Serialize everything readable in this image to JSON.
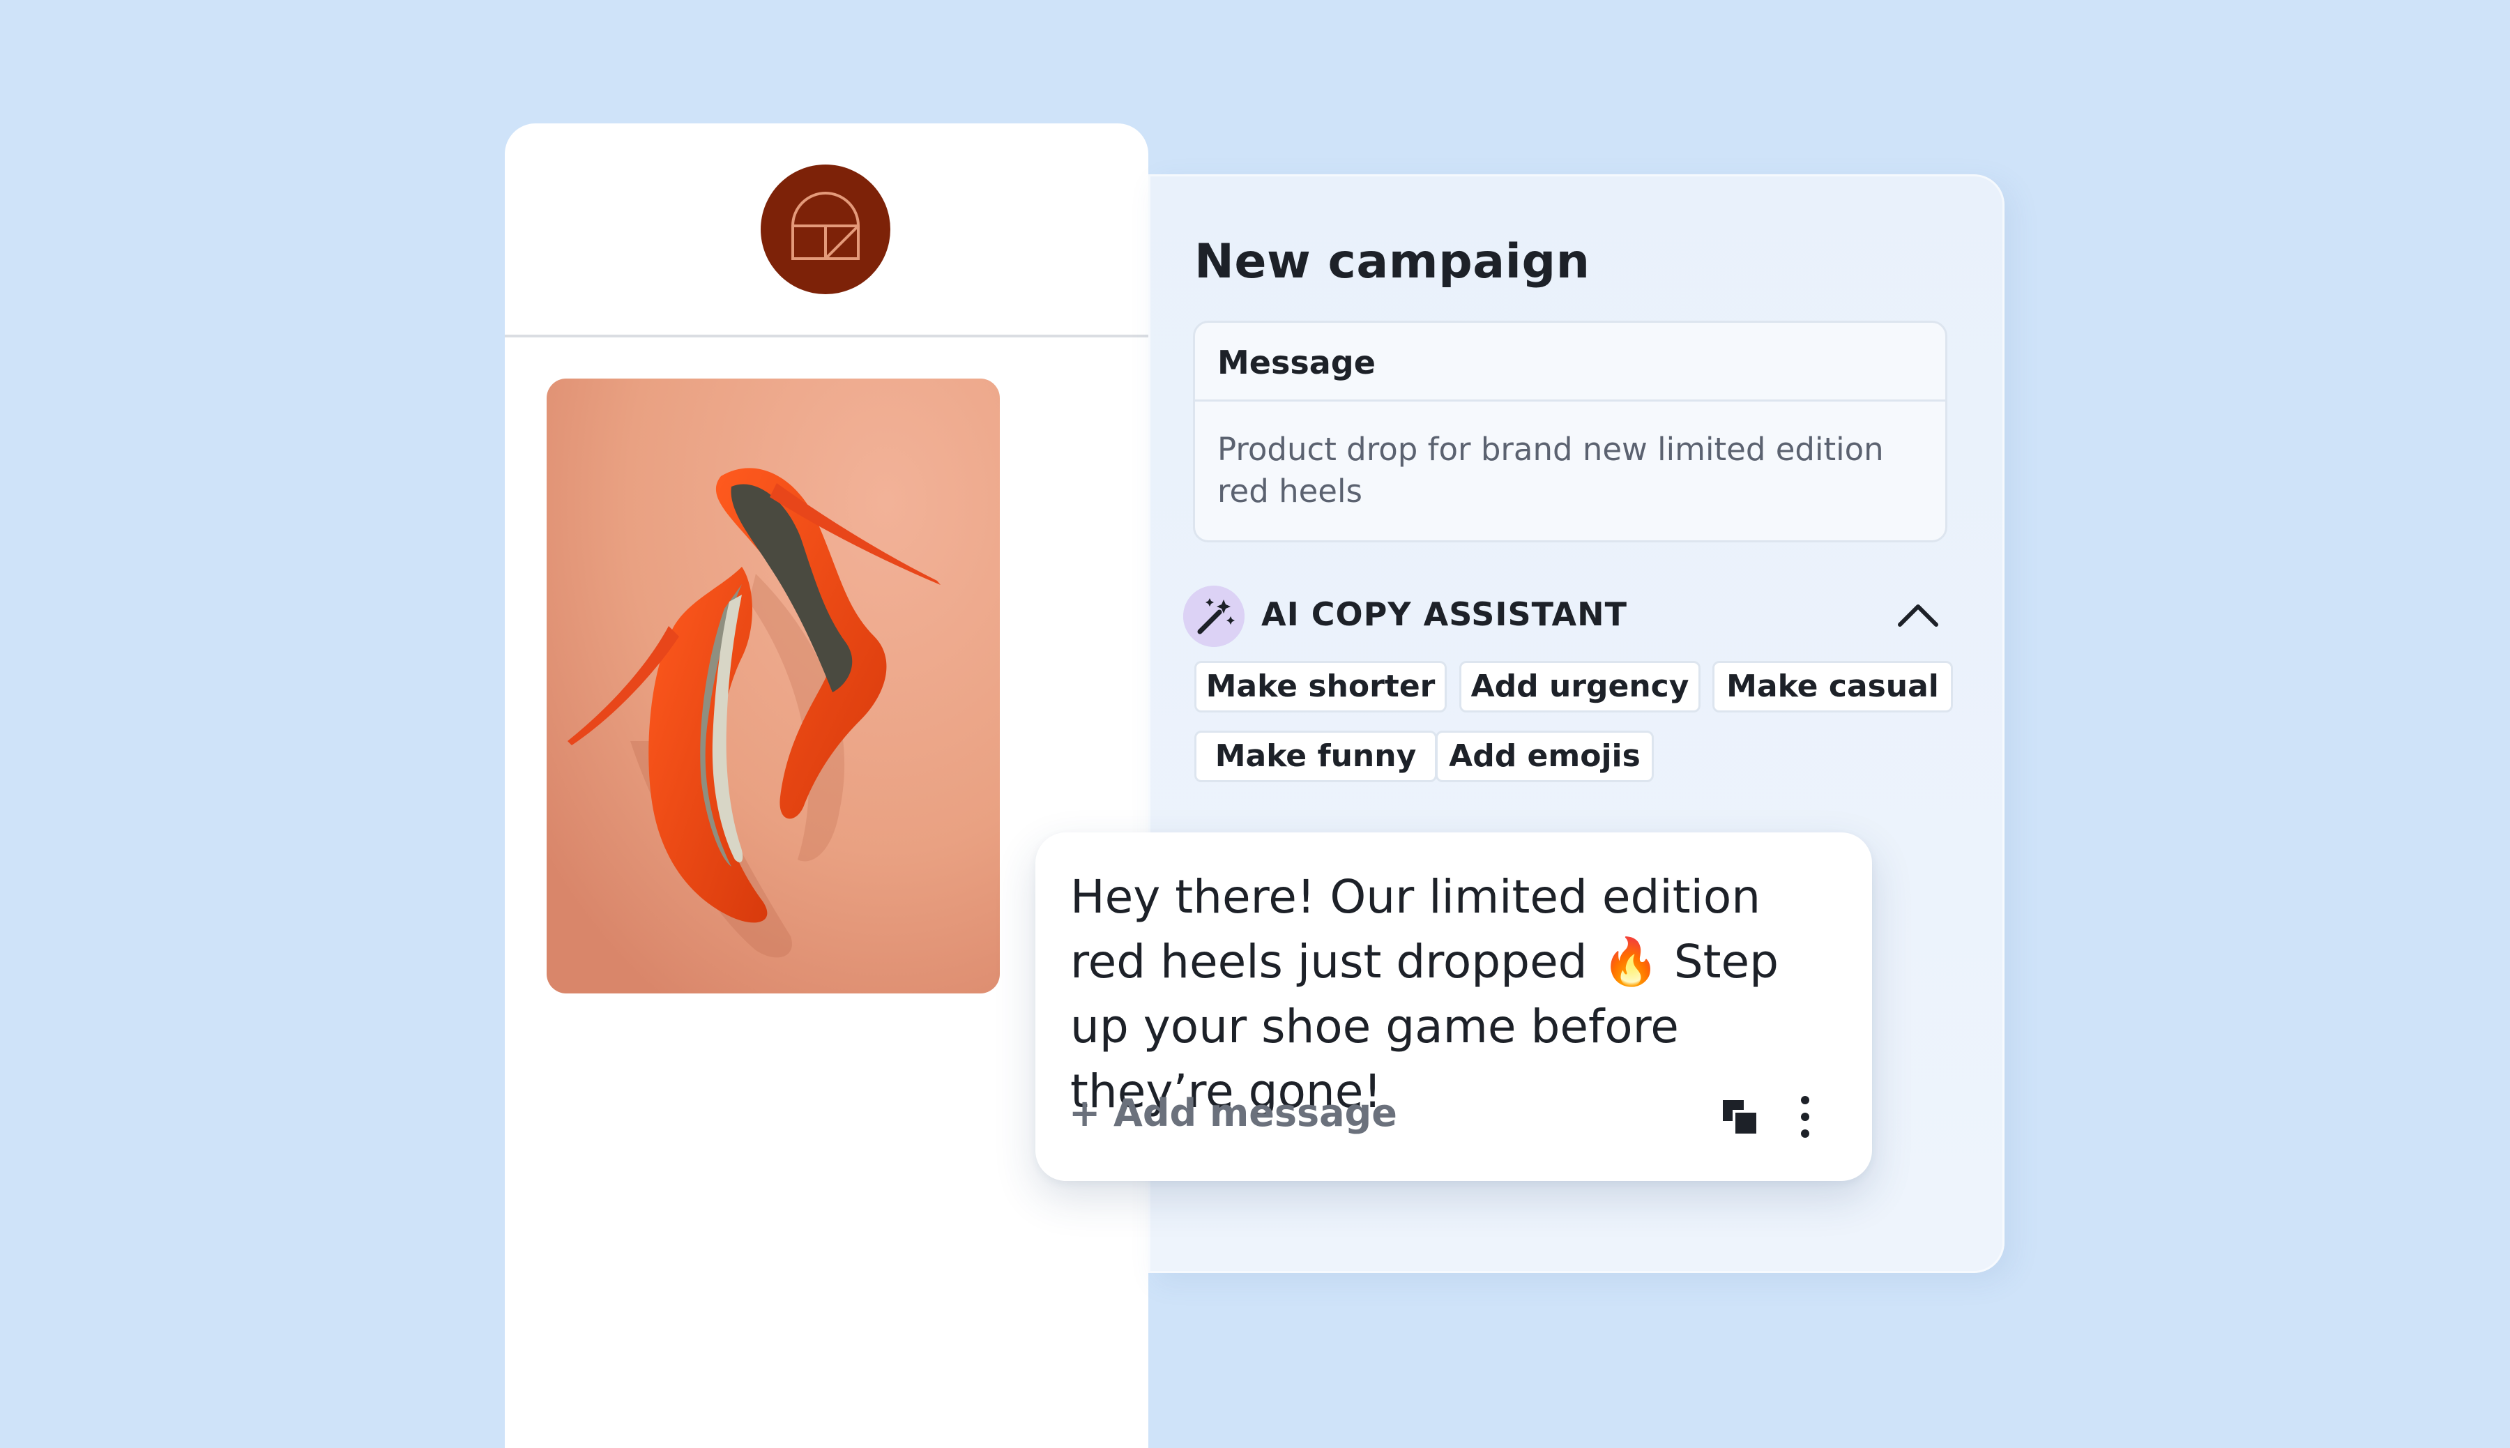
{
  "phone_preview": {
    "logo": "storefront-arch-logo",
    "product_image": "red-high-heels-photo"
  },
  "campaign": {
    "title": "New campaign",
    "message": {
      "label": "Message",
      "text": "Product drop for brand new limited edition red heels"
    },
    "ai_assistant": {
      "icon": "magic-wand-icon",
      "label": "AI COPY ASSISTANT",
      "toggle_icon": "chevron-up-icon",
      "chips": [
        {
          "label": "Make shorter"
        },
        {
          "label": "Add urgency"
        },
        {
          "label": "Make casual"
        },
        {
          "label": "Make funny"
        },
        {
          "label": "Add emojis"
        }
      ]
    }
  },
  "generated_message": {
    "text": "Hey there! Our limited edition red heels just dropped 🔥 Step up your shoe game before they’re gone!",
    "add_message_label": "+ Add message",
    "actions": [
      "copy-icon",
      "more-options-icon"
    ]
  },
  "colors": {
    "background": "#cfe3f9",
    "logo_brown": "#7d2208",
    "logo_line": "#e49a7a",
    "image_backdrop": "#eba88a",
    "heel_orange": "#f04a14",
    "text_dark": "#1d2128",
    "text_muted": "#5b6270"
  }
}
